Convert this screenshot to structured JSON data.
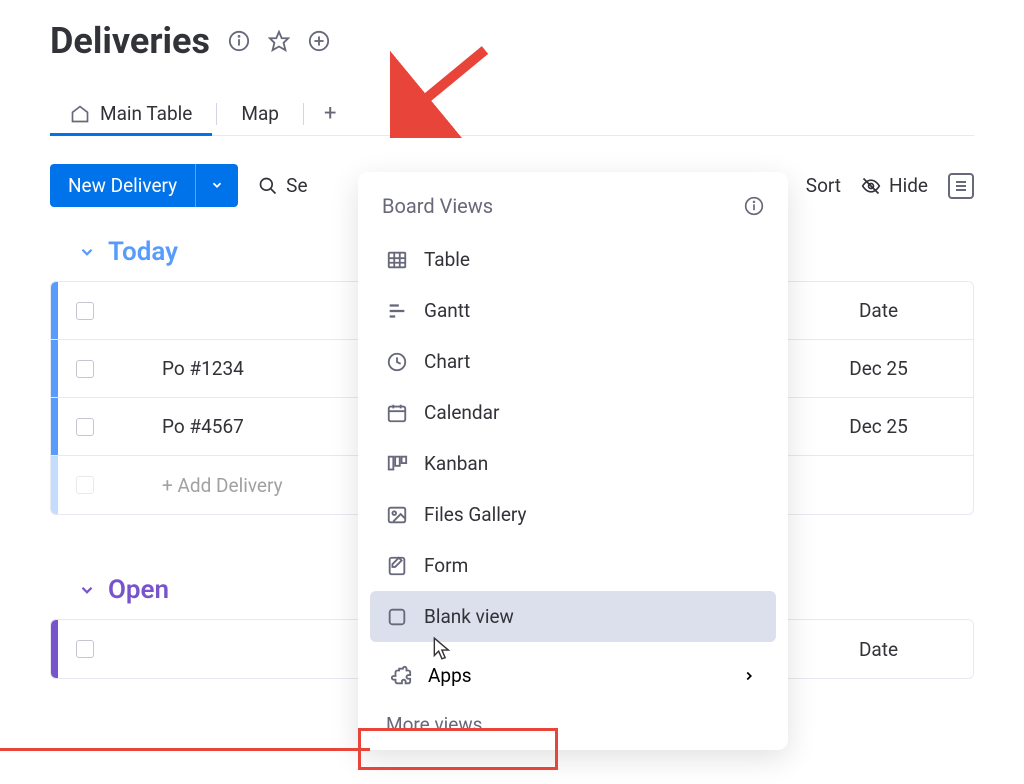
{
  "header": {
    "title": "Deliveries"
  },
  "tabs": {
    "main": "Main Table",
    "map": "Map"
  },
  "toolbar": {
    "new_label": "New Delivery",
    "search_placeholder": "Se",
    "sort": "Sort",
    "hide": "Hide"
  },
  "groups": {
    "today": {
      "title": "Today",
      "date_header": "Date",
      "rows": [
        {
          "name": "Po #1234",
          "date": "Dec 25"
        },
        {
          "name": "Po #4567",
          "date": "Dec 25"
        }
      ],
      "add_label": "+ Add Delivery"
    },
    "open": {
      "title": "Open",
      "date_header": "Date"
    }
  },
  "views_panel": {
    "header": "Board Views",
    "items": [
      "Table",
      "Gantt",
      "Chart",
      "Calendar",
      "Kanban",
      "Files Gallery",
      "Form",
      "Blank view"
    ],
    "apps": "Apps",
    "more": "More views"
  }
}
